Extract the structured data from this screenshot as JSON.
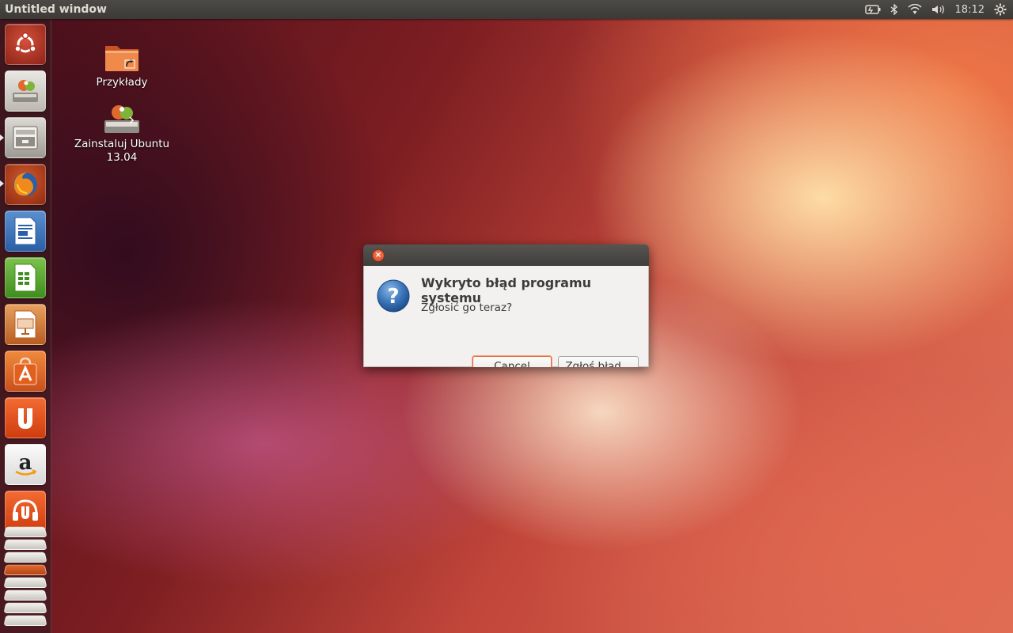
{
  "top_panel": {
    "window_title": "Untitled window",
    "clock": "18:12",
    "indicators": [
      "battery-icon",
      "bluetooth-icon",
      "wifi-icon",
      "volume-icon",
      "settings-gear-icon"
    ]
  },
  "desktop": {
    "icons": [
      {
        "label": "Przykłady",
        "icon": "folder-icon"
      },
      {
        "label": "Zainstaluj Ubuntu 13.04",
        "icon": "installer-icon"
      }
    ]
  },
  "launcher": {
    "items": [
      "dash-icon",
      "installer-icon",
      "files-icon",
      "firefox-icon",
      "writer-icon",
      "calc-icon",
      "impress-icon",
      "software-center-icon",
      "ubuntu-one-icon",
      "amazon-icon",
      "ubuntu-one-music-icon"
    ]
  },
  "dialog": {
    "heading": "Wykryto błąd programu systemu",
    "message": "Zgłosić go teraz?",
    "cancel_label": "Cancel",
    "report_label": "Zgłoś błąd...",
    "close_glyph": "×",
    "question_glyph": "?"
  },
  "colors": {
    "accent_orange": "#e26a3a",
    "panel": "#3b3a36",
    "dialog_bg": "#f2f1f0"
  }
}
